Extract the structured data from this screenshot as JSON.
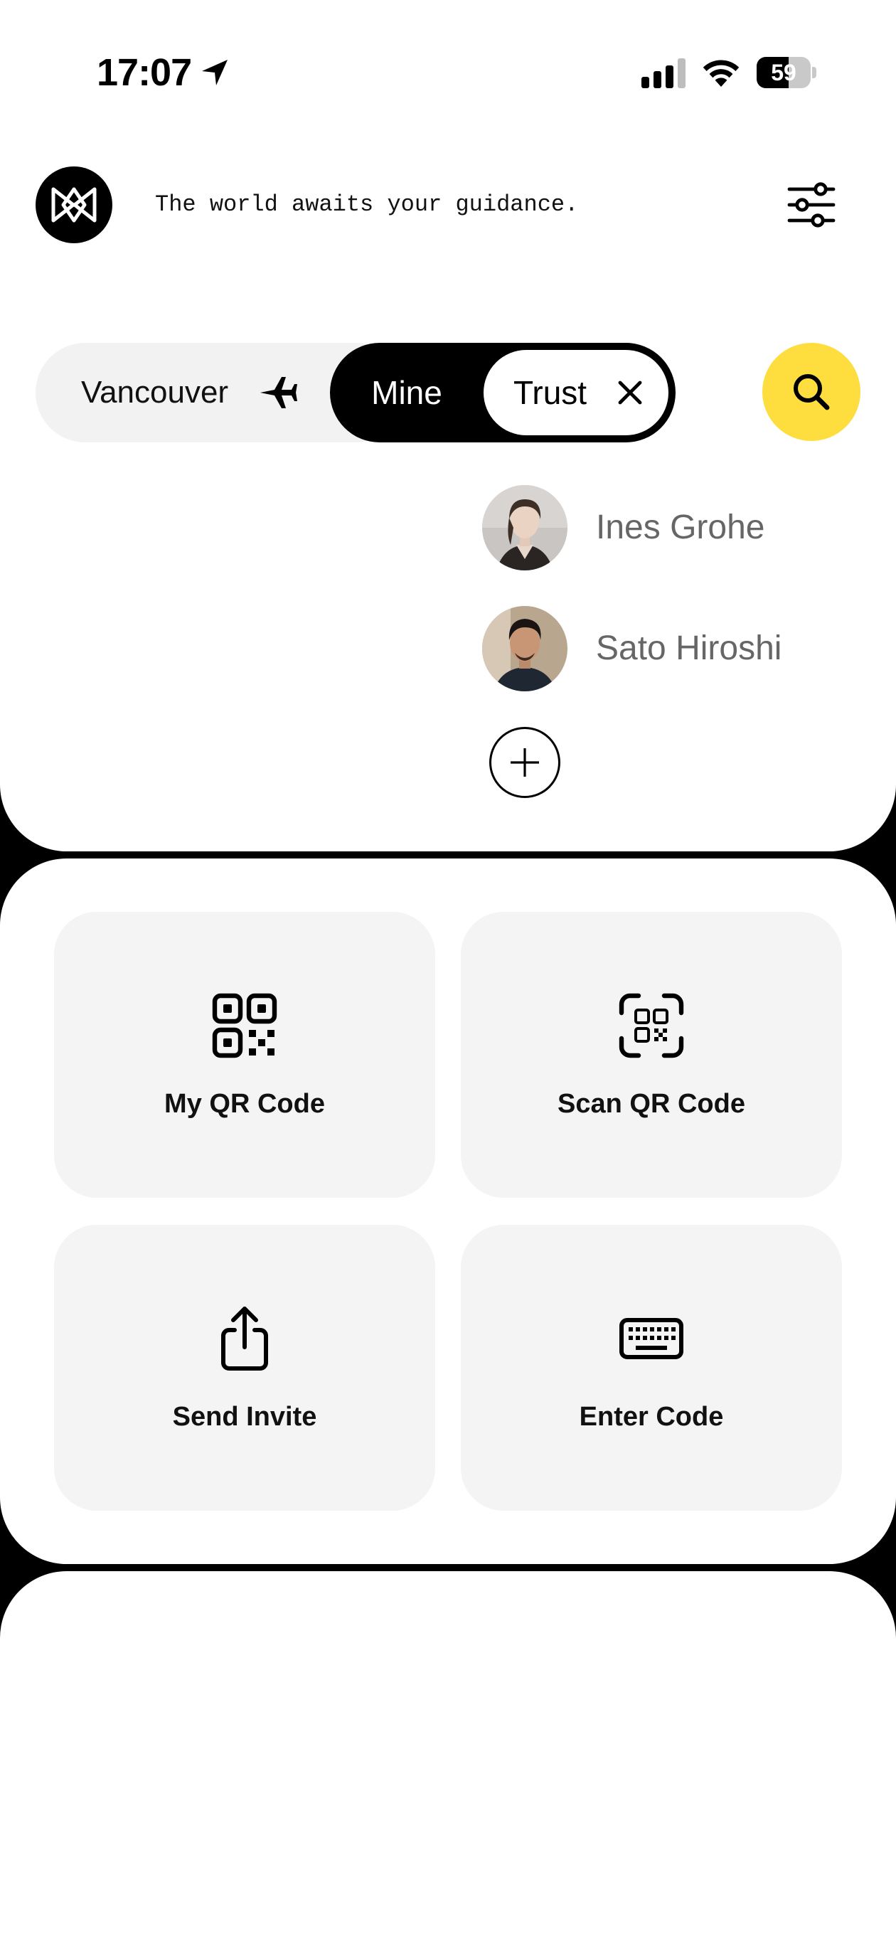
{
  "status_bar": {
    "time": "17:07",
    "battery_percent": "59",
    "icons": [
      "location-arrow-icon",
      "signal-icon",
      "wifi-icon",
      "battery-icon"
    ]
  },
  "header": {
    "tagline": "The world awaits your guidance.",
    "logo_icon": "bowtie-logo-icon",
    "filter_icon": "sliders-icon"
  },
  "toggle_row": {
    "location": "Vancouver",
    "location_icon": "airplane-icon",
    "segments": [
      "Mine",
      "Trust"
    ],
    "selected_segment": "Trust",
    "clear_icon": "close-icon",
    "search_icon": "search-icon"
  },
  "contacts": [
    {
      "name": "Ines Grohe"
    },
    {
      "name": "Sato Hiroshi"
    }
  ],
  "add_contact_icon": "plus-circle-icon",
  "actions": [
    {
      "label": "My QR Code",
      "icon": "qr-code-icon"
    },
    {
      "label": "Scan QR Code",
      "icon": "qr-scan-icon"
    },
    {
      "label": "Send Invite",
      "icon": "share-icon"
    },
    {
      "label": "Enter Code",
      "icon": "keyboard-icon"
    }
  ],
  "colors": {
    "accent_yellow": "#fedd3f",
    "tile_bg": "#f4f4f4",
    "pill_bg": "#f2f2f2",
    "name_gray": "#666666"
  }
}
